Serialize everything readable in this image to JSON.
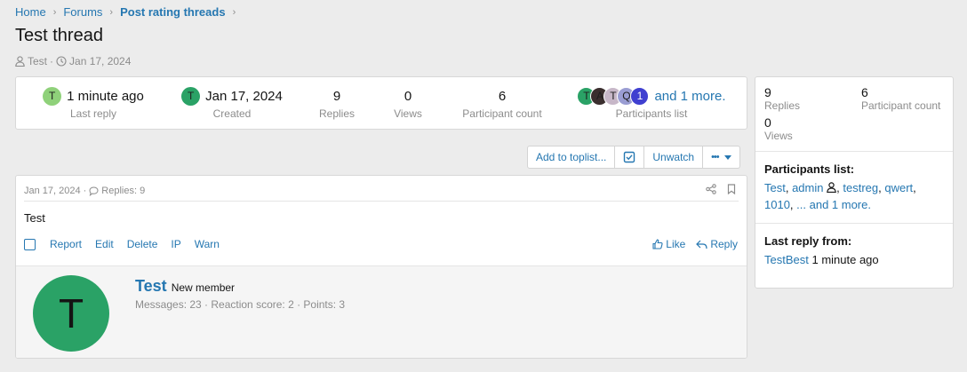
{
  "breadcrumb": {
    "items": [
      "Home",
      "Forums",
      "Post rating threads"
    ],
    "sep": "›"
  },
  "thread": {
    "title": "Test thread",
    "author": "Test",
    "sep": "·",
    "date": "Jan 17, 2024"
  },
  "stats": {
    "last_reply_avatar": "T",
    "last_reply_avatar_color": "#8fd17a",
    "last_reply": "1 minute ago",
    "last_reply_label": "Last reply",
    "created_avatar": "T",
    "created_avatar_color": "#2aa266",
    "created": "Jan 17, 2024",
    "created_label": "Created",
    "replies": "9",
    "replies_label": "Replies",
    "views": "0",
    "views_label": "Views",
    "participants": "6",
    "participants_label": "Participant count",
    "participants_more": "and 1 more.",
    "participants_list_label": "Participants list",
    "stacked_avatars": [
      {
        "letter": "T",
        "color": "#2aa266"
      },
      {
        "letter": "A",
        "color": "#3a2e2e"
      },
      {
        "letter": "T",
        "color": "#c7b7c8"
      },
      {
        "letter": "Q",
        "color": "#9a9dd3"
      },
      {
        "letter": "1",
        "color": "#3f3fd0"
      }
    ]
  },
  "sidebar": {
    "replies": "9",
    "replies_label": "Replies",
    "participants": "6",
    "participants_label": "Participant count",
    "views": "0",
    "views_label": "Views",
    "participants_title": "Participants list:",
    "p1": "Test",
    "p2": "admin",
    "p3": "testreg",
    "p4": "qwert",
    "p5": "1010",
    "p_more": "... and 1 more.",
    "last_reply_title": "Last reply from:",
    "last_reply_user": "TestBest",
    "last_reply_time": "1 minute ago"
  },
  "toolbar": {
    "toplist": "Add to toplist...",
    "unwatch": "Unwatch",
    "more": "•••"
  },
  "post": {
    "date": "Jan 17, 2024",
    "sep": "·",
    "replies": "Replies: 9",
    "body": "Test",
    "actions": [
      "Report",
      "Edit",
      "Delete",
      "IP",
      "Warn"
    ],
    "like": "Like",
    "reply": "Reply"
  },
  "member": {
    "avatar_letter": "T",
    "name": "Test",
    "title": "New member",
    "stats": "Messages: 23 · Reaction score: 2 · Points: 3"
  },
  "colors": {
    "link": "#2577b1",
    "muted": "#8c8c8c",
    "bg": "#ececec"
  }
}
